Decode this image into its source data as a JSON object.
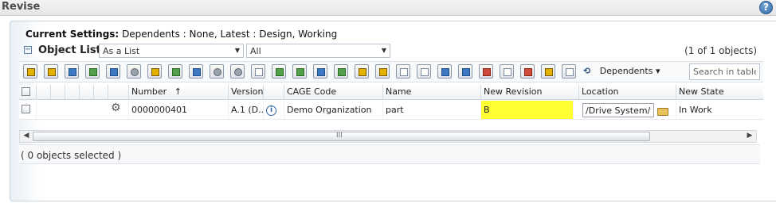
{
  "window": {
    "title": "Revise",
    "help_label": "?"
  },
  "settings": {
    "label": "Current Settings:",
    "value": "Dependents : None, Latest : Design, Working"
  },
  "object_list": {
    "title": "Object List",
    "collapse_symbol": "−",
    "view_select": "As a List",
    "filter_select": "All",
    "count": "(1 of 1 objects)"
  },
  "toolbar": {
    "icons": [
      "settings-icon",
      "add-object-icon",
      "add-dependents-icon",
      "expand-icon",
      "collect-icon",
      "select-icon",
      "insert-icon",
      "structure-icon",
      "move-icon",
      "refresh-icon",
      "options-icon",
      "copy-icon",
      "paste-icon",
      "set-location-icon",
      "edit-icon",
      "reset-icon",
      "add-row-icon",
      "filter-icon",
      "columns-icon",
      "check-icon",
      "arrange-icon",
      "sort-icon",
      "remove-icon",
      "clear-icon",
      "delete-icon",
      "folder-icon",
      "approve-icon"
    ],
    "dependents_label": "Dependents",
    "search_placeholder": "Search in table"
  },
  "table": {
    "columns": [
      "Number",
      "Version",
      "CAGE Code",
      "Name",
      "New Revision",
      "Location",
      "New State"
    ],
    "sort_indicator": "↑",
    "rows": [
      {
        "number": "0000000401",
        "version": "A.1 (D...",
        "cage_code": "Demo Organization",
        "name": "part",
        "new_revision": "B",
        "location": "/Drive System/tes",
        "new_state": "In Work"
      }
    ]
  },
  "scrollbar": {
    "grip": "III",
    "left_arrow": "◀",
    "right_arrow": "▶"
  },
  "status": {
    "selected": "( 0 objects selected )"
  },
  "colors": {
    "revision_highlight": "#ffff33",
    "accent": "#2f68a8"
  }
}
